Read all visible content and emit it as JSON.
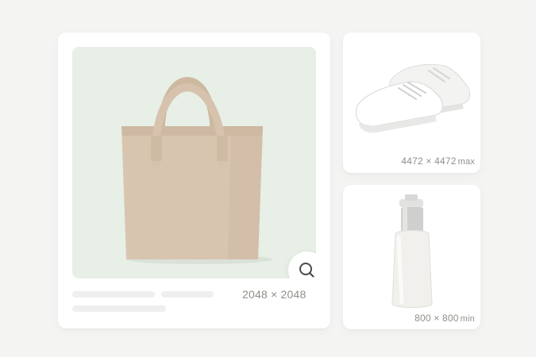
{
  "gallery": {
    "main": {
      "image_alt": "beige tote bag",
      "dimensions": "2048 × 2048",
      "zoom_icon": "search-icon"
    },
    "side": [
      {
        "image_alt": "white sneakers",
        "dimensions": "4472 × 4472",
        "qualifier": "max"
      },
      {
        "image_alt": "white pump bottle",
        "dimensions": "800 × 800",
        "qualifier": "min"
      }
    ]
  },
  "colors": {
    "background": "#f4f4f3",
    "card": "#ffffff",
    "main_image_bg": "#e7efe7",
    "label": "#8f8f88"
  }
}
